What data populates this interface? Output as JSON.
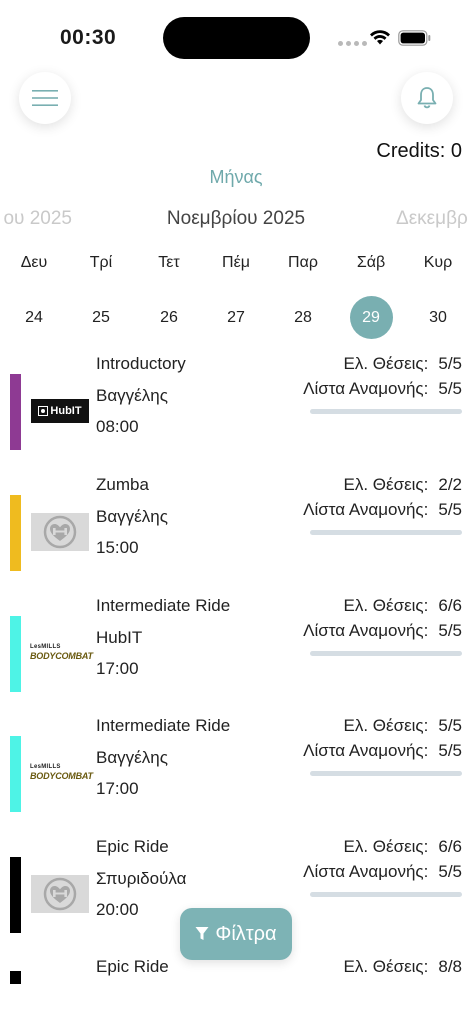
{
  "status": {
    "time": "00:30"
  },
  "header": {
    "credits": "Credits: 0",
    "month_link": "Μήνας"
  },
  "months": {
    "prev": "ου 2025",
    "current": "Νοεμβρίου 2025",
    "next": "Δεκεμβρ"
  },
  "days": [
    {
      "name": "Δευ",
      "num": "24",
      "selected": false
    },
    {
      "name": "Τρί",
      "num": "25",
      "selected": false
    },
    {
      "name": "Τετ",
      "num": "26",
      "selected": false
    },
    {
      "name": "Πέμ",
      "num": "27",
      "selected": false
    },
    {
      "name": "Παρ",
      "num": "28",
      "selected": false
    },
    {
      "name": "Σάβ",
      "num": "29",
      "selected": true
    },
    {
      "name": "Κυρ",
      "num": "30",
      "selected": false
    }
  ],
  "labels": {
    "seats": "Ελ. Θέσεις:",
    "waitlist": "Λίστα Αναμονής:"
  },
  "logos": {
    "hubit": "HubIT",
    "lesmills": "LesMILLS",
    "bodycombat": "BODYCOMBAT"
  },
  "classes": [
    {
      "title": "Introductory",
      "trainer": "Βαγγέλης",
      "time": "08:00",
      "seats": "5/5",
      "waitlist": "5/5",
      "color": "#8e3a93",
      "logo": "hubit"
    },
    {
      "title": "Zumba",
      "trainer": "Βαγγέλης",
      "time": "15:00",
      "seats": "2/2",
      "waitlist": "5/5",
      "color": "#efbb1f",
      "logo": "heart"
    },
    {
      "title": "Intermediate Ride",
      "trainer": "HubIT",
      "time": "17:00",
      "seats": "6/6",
      "waitlist": "5/5",
      "color": "#4ef3e6",
      "logo": "bodycombat"
    },
    {
      "title": "Intermediate Ride",
      "trainer": "Βαγγέλης",
      "time": "17:00",
      "seats": "5/5",
      "waitlist": "5/5",
      "color": "#4ef3e6",
      "logo": "bodycombat"
    },
    {
      "title": "Epic Ride",
      "trainer": "Σπυριδούλα",
      "time": "20:00",
      "seats": "6/6",
      "waitlist": "5/5",
      "color": "#000000",
      "logo": "heart"
    },
    {
      "title": "Epic Ride",
      "trainer": "",
      "time": "",
      "seats": "8/8",
      "waitlist": "",
      "color": "#000000",
      "logo": "none"
    }
  ],
  "filter": {
    "label": "Φίλτρα"
  },
  "icons": {
    "menu": "hamburger-menu-icon",
    "bell": "bell-icon",
    "filter": "filter-funnel-icon",
    "logo_heart": "heart-dumbbell-icon"
  },
  "colors": {
    "accent": "#79afb1",
    "filter_button": "#7db3b5",
    "progress_track": "#d5dde3"
  }
}
